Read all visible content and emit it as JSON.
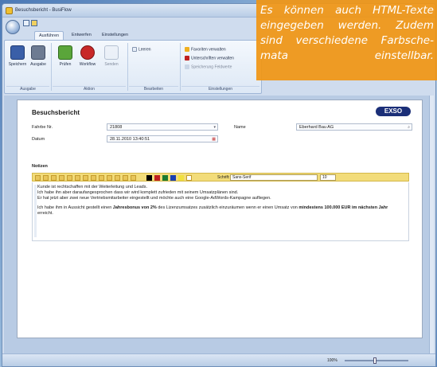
{
  "window": {
    "title": "Besuchsbericht - BusiFlow"
  },
  "ribbon": {
    "tabs": [
      "Ausführen",
      "Entwerfen",
      "Einstellungen"
    ],
    "active_tab": 0,
    "buttons": [
      {
        "label": "Speichern",
        "icon": "save-icon"
      },
      {
        "label": "Ausgabe",
        "icon": "print-icon"
      },
      {
        "label": "Prüfen",
        "icon": "check-icon"
      },
      {
        "label": "Workflow",
        "icon": "workflow-icon"
      },
      {
        "label": "Senden",
        "icon": "mail-icon"
      }
    ],
    "edit_command": "Leeren",
    "settings_commands": [
      "Favoriten verwalten",
      "Unterschriften verwalten",
      "Speicherung Feldwerte"
    ],
    "groups": [
      "Ausgabe",
      "Aktion",
      "Bearbeiten",
      "Einstellungen"
    ]
  },
  "report": {
    "title": "Besuchsbericht",
    "logo": "EXSO",
    "fields": [
      {
        "label": "Fahrbe Nr.",
        "value": "21808"
      },
      {
        "label": "Datum",
        "value": "28.11.2010 13:40:51"
      },
      {
        "label": "Name",
        "value": "Eberhard Bau AG"
      }
    ],
    "notes_label": "Notizen",
    "font_label": "Schrift:",
    "font_value": "Sans-Serif",
    "size_value": "10",
    "toolbar_colors": [
      "#000000",
      "#c02020",
      "#1a7a30",
      "#1a40b0",
      "#f0e040",
      "#ffffff"
    ],
    "notes_lines": [
      "Kunde ist rechtschaffen mit der Weiterleitung und Leads.",
      "Ich habe ihn aber daraufangesprochen dass wir wird komplett zufrieden mit seinem Umsatzplänen sind.",
      "Er hat jetzt aber zwei neue Vertriebsmitarbeiter eingestellt und möchte auch eine Google-AdWords-Kampagne aufliegen."
    ],
    "notes_para_2_prefix": "Ich habe ihm in Aussicht gestellt einen ",
    "notes_para_2_bold_1": "Jahresbonus von 2%",
    "notes_para_2_mid": " des Lizenzumsatzes zusätzlich einzuräumen wenn er einen Umsatz von ",
    "notes_para_2_bold_2": "mindestens 100.000 EUR im nächsten Jahr",
    "notes_para_2_suffix": " erreicht."
  },
  "statusbar": {
    "zoom": "100%"
  },
  "callout": {
    "text": "Es können auch HTML-Texte eingegeben werden. Zudem sind verschiedene Farbsche-mata einstellbar."
  },
  "colors": {
    "callout_bg": "#f0961a",
    "logo_bg": "#1b2f78",
    "notes_toolbar_bg": "#f2dc7a"
  }
}
